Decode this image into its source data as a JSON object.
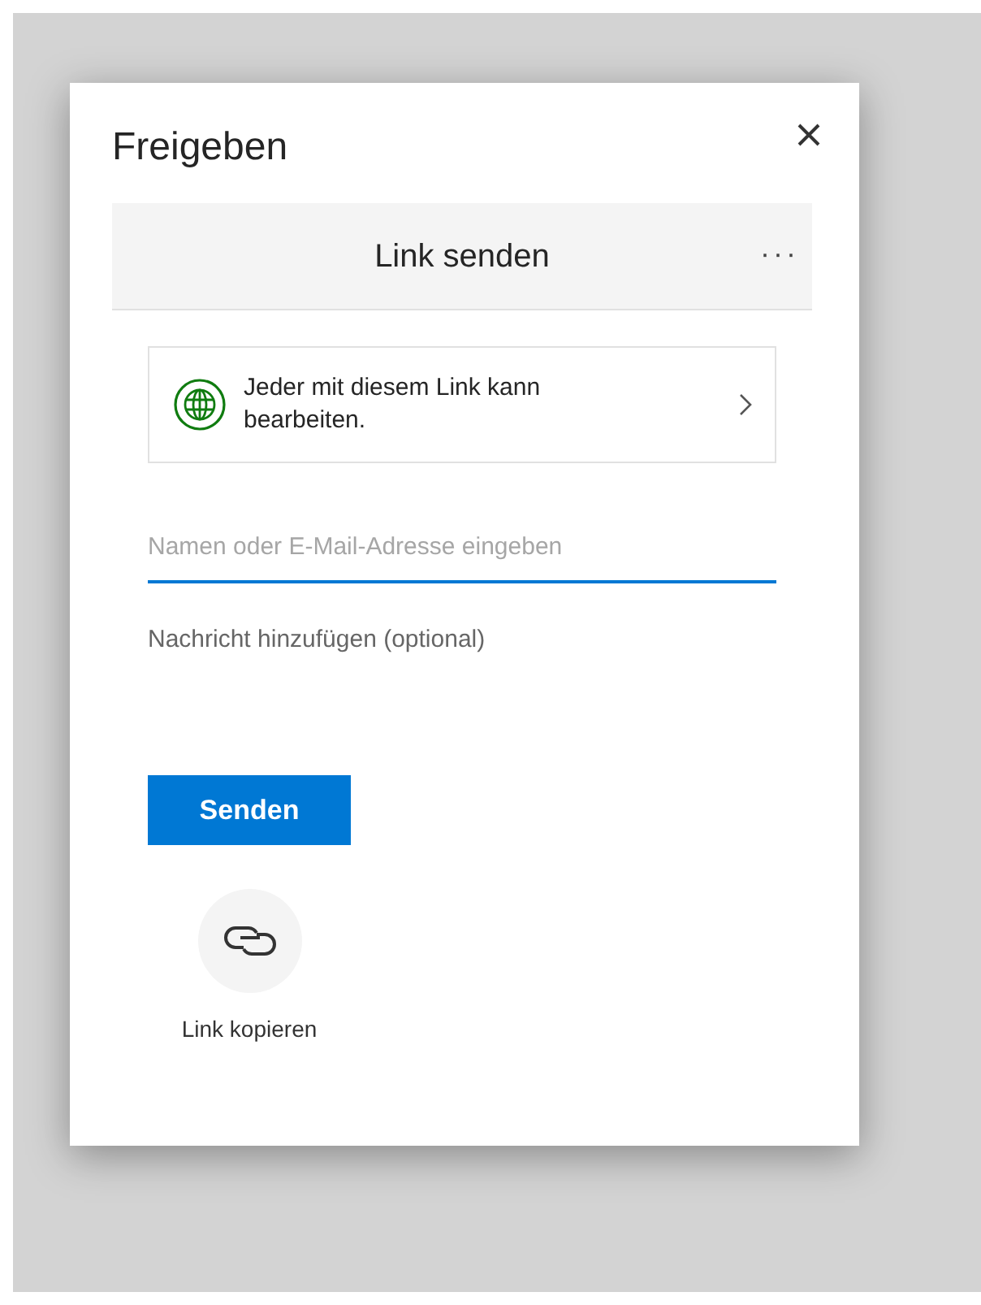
{
  "dialog": {
    "title": "Freigeben",
    "header": {
      "title": "Link senden",
      "more": "···"
    },
    "permission": {
      "text": "Jeder mit diesem Link kann bearbeiten."
    },
    "recipients": {
      "placeholder": "Namen oder E-Mail-Adresse eingeben"
    },
    "message": {
      "placeholder": "Nachricht hinzufügen (optional)"
    },
    "send_button": "Senden",
    "copy_link": {
      "label": "Link kopieren"
    }
  }
}
